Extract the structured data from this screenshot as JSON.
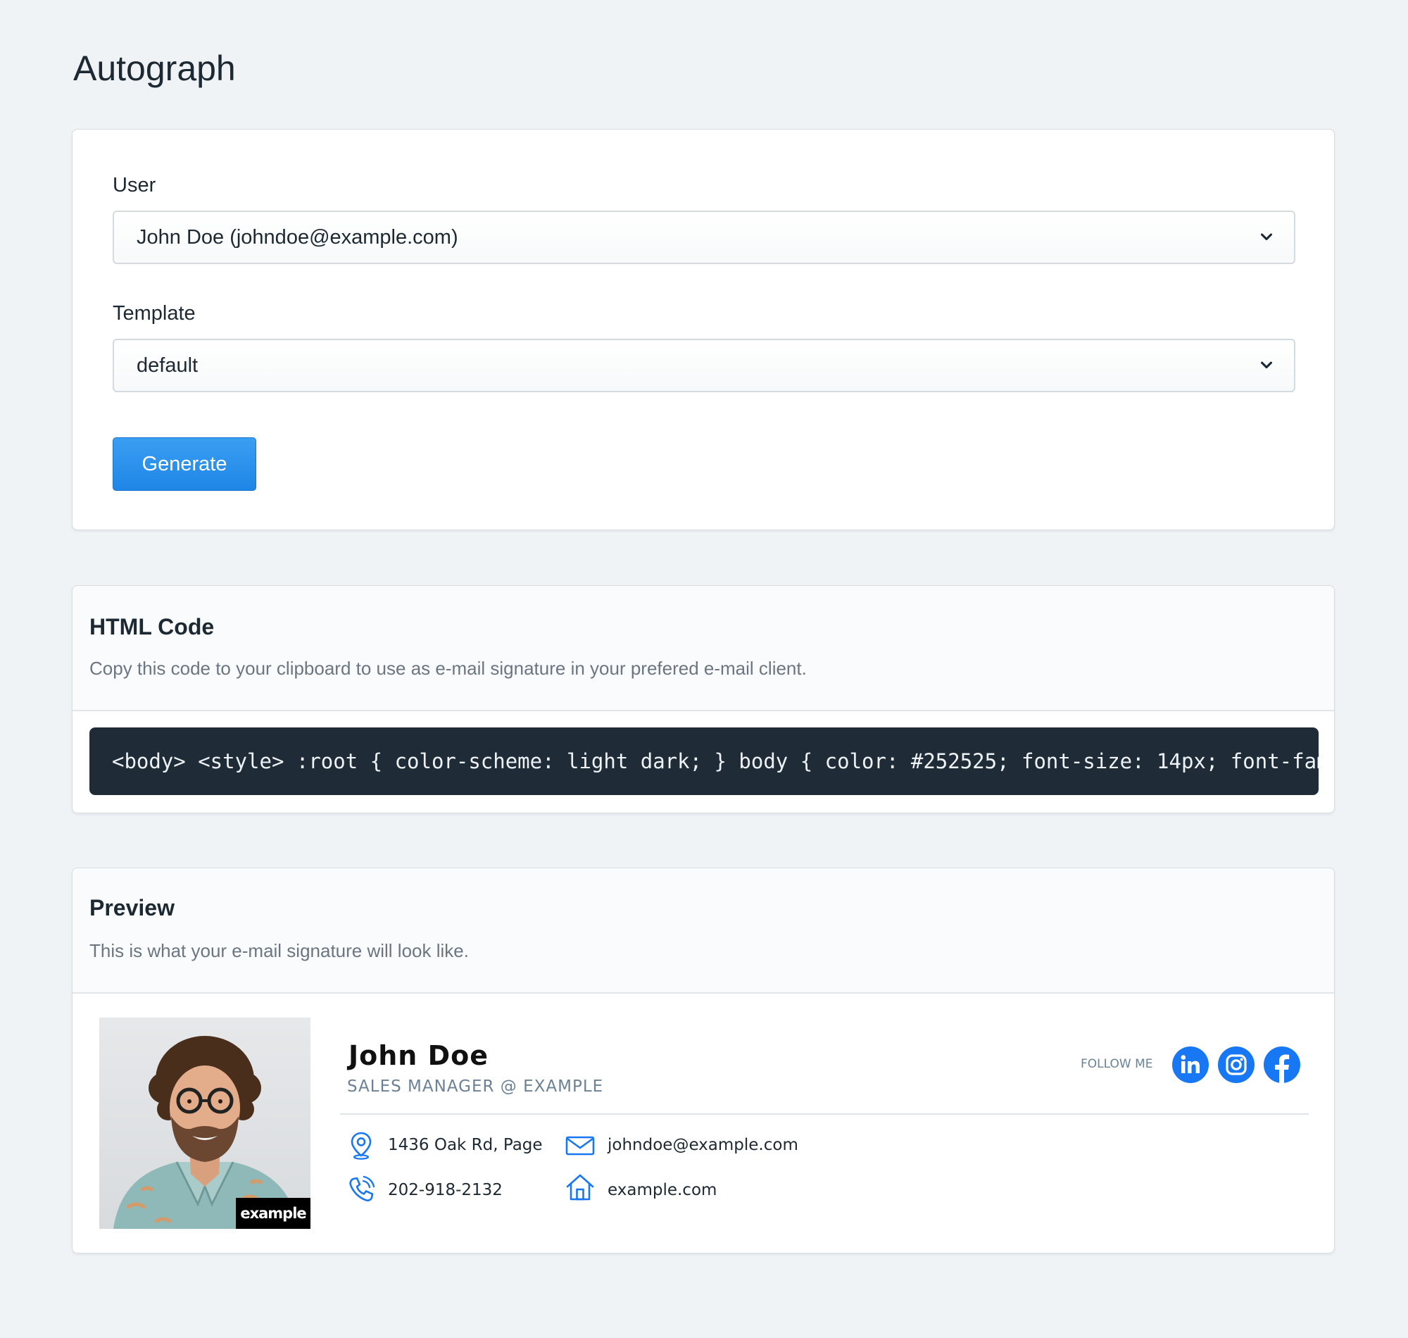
{
  "page": {
    "title": "Autograph"
  },
  "form": {
    "user_label": "User",
    "user_value": "John Doe (johndoe@example.com)",
    "template_label": "Template",
    "template_value": "default",
    "generate_label": "Generate"
  },
  "code_card": {
    "title": "HTML Code",
    "description": "Copy this code to your clipboard to use as e-mail signature in your prefered e-mail client.",
    "code": "<body> <style> :root { color-scheme: light dark; } body { color: #252525; font-size: 14px; font-family: \"Open Sans\", sans-serif; }"
  },
  "preview_card": {
    "title": "Preview",
    "description": "This is what your e-mail signature will look like."
  },
  "signature": {
    "name": "John Doe",
    "role": "SALES MANAGER @ EXAMPLE",
    "follow_label": "FOLLOW ME",
    "badge": "example",
    "address": "1436 Oak Rd, Page",
    "phone": "202-918-2132",
    "email": "johndoe@example.com",
    "website": "example.com",
    "social": [
      "linkedin-icon",
      "instagram-icon",
      "facebook-icon"
    ]
  },
  "colors": {
    "background": "#eff3f6",
    "accent": "#1f86e6",
    "code_bg": "#1f2c38",
    "icon_blue": "#1877f2"
  }
}
